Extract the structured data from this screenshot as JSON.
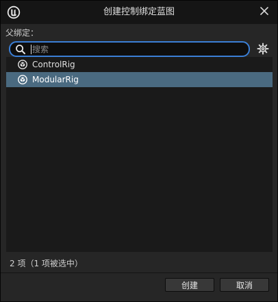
{
  "window": {
    "title": "创建控制绑定蓝图"
  },
  "parent_label": "父绑定：",
  "search": {
    "placeholder": "搜索",
    "value": ""
  },
  "list": {
    "items": [
      {
        "label": "ControlRig",
        "icon": "control-rig-icon",
        "selected": false
      },
      {
        "label": "ModularRig",
        "icon": "control-rig-icon",
        "selected": true
      }
    ]
  },
  "status": "2 项（1 项被选中）",
  "buttons": {
    "create": "创建",
    "cancel": "取消"
  },
  "colors": {
    "accent": "#3b7fd6",
    "selection": "#4a6a80",
    "background": "#262626",
    "list_background": "#1a1a1a",
    "titlebar": "#151515"
  }
}
